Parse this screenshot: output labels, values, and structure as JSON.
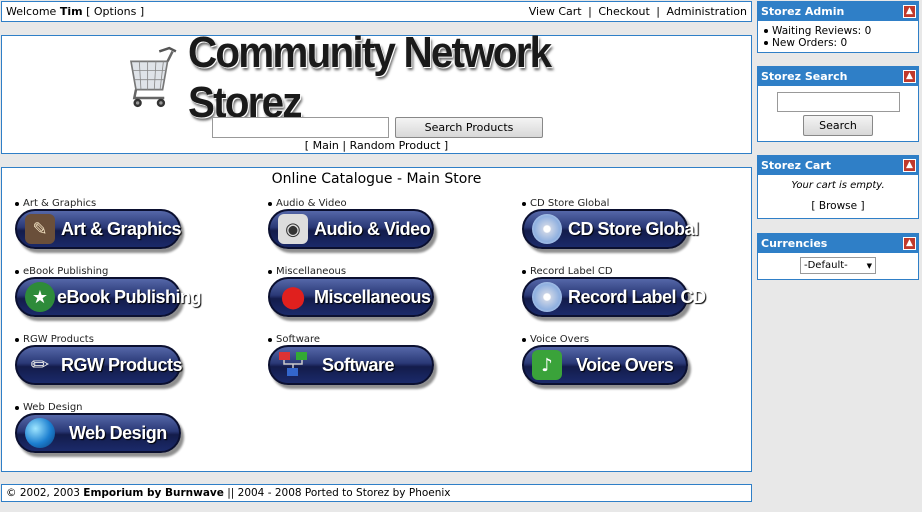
{
  "topbar": {
    "welcome": "Welcome",
    "user": "Tim",
    "options_open": "[",
    "options": "Options",
    "options_close": "]",
    "links": [
      "View Cart",
      "Checkout",
      "Administration"
    ],
    "sep": "|"
  },
  "header": {
    "logo_text": "Community Network Storez",
    "search_placeholder": "",
    "search_button": "Search Products",
    "nav_open": "[",
    "nav_main": "Main",
    "nav_sep": "|",
    "nav_random": "Random Product",
    "nav_close": "]"
  },
  "catalogue": {
    "title": "Online Catalogue - Main Store",
    "categories": [
      {
        "label": "Art & Graphics",
        "button": "Art & Graphics",
        "icon": "art-icon"
      },
      {
        "label": "Audio & Video",
        "button": "Audio & Video",
        "icon": "camera-icon"
      },
      {
        "label": "CD Store Global",
        "button": "CD Store Global",
        "icon": "cd-icon"
      },
      {
        "label": "eBook Publishing",
        "button": "eBook Publishing",
        "icon": "ebook-icon"
      },
      {
        "label": "Miscellaneous",
        "button": "Miscellaneous",
        "icon": "ladybug-icon"
      },
      {
        "label": "Record Label CD",
        "button": "Record Label CD",
        "icon": "cd-icon"
      },
      {
        "label": "RGW Products",
        "button": "RGW Products",
        "icon": "microphone-icon"
      },
      {
        "label": "Software",
        "button": "Software",
        "icon": "network-icon"
      },
      {
        "label": "Voice Overs",
        "button": "Voice Overs",
        "icon": "mic-icon"
      },
      {
        "label": "Web Design",
        "button": "Web Design",
        "icon": "globe-icon"
      }
    ]
  },
  "footer": {
    "text_a": "© 2002, 2003 ",
    "bold_a": "Emporium by Burnwave",
    "text_b": " || 2004 - 2008 Ported to Storez by Phoenix"
  },
  "sidebar": {
    "admin": {
      "title": "Storez Admin",
      "items": [
        {
          "label": "Waiting Reviews:",
          "value": "0"
        },
        {
          "label": "New Orders:",
          "value": "0"
        }
      ]
    },
    "search": {
      "title": "Storez Search",
      "button": "Search"
    },
    "cart": {
      "title": "Storez Cart",
      "empty_text": "Your cart is empty.",
      "browse_open": "[",
      "browse": "Browse",
      "browse_close": "]"
    },
    "currencies": {
      "title": "Currencies",
      "selected": "-Default-"
    }
  },
  "colors": {
    "accent": "#2f7fc7",
    "pill": "#1b2a6a",
    "collapse": "#c0392b"
  }
}
